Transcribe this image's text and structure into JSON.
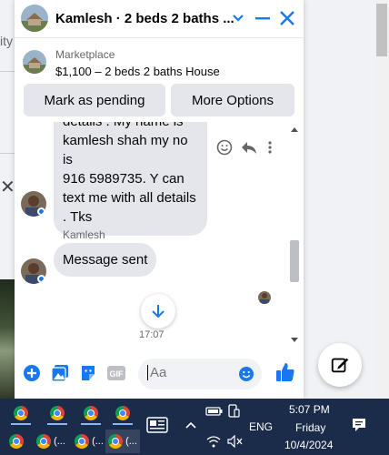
{
  "background": {
    "partial_text": "ity"
  },
  "chat": {
    "title": "Kamlesh · 2 beds 2 baths ...",
    "listing": {
      "source": "Marketplace",
      "title": "$1,100 – 2 beds 2 baths House"
    },
    "buttons": {
      "mark_pending": "Mark as pending",
      "more_options": "More Options"
    },
    "messages": [
      {
        "sender": "",
        "lines": [
          "details . My name is",
          "kamlesh shah my no is",
          "916 5989735. Y can",
          "text me with all details",
          ". Tks"
        ]
      },
      {
        "sender": "Kamlesh",
        "text": "Message sent"
      }
    ],
    "timestamp": "17:07",
    "composer": {
      "placeholder": "Aa"
    },
    "accent_color": "#1877f2"
  },
  "taskbar": {
    "apps_row1": [
      "",
      "",
      "",
      "",
      ""
    ],
    "apps_row2": [
      "(...",
      "(...",
      "(...",
      "(..."
    ],
    "language": "ENG",
    "time": "5:07 PM",
    "day": "Friday",
    "date": "10/4/2024"
  }
}
